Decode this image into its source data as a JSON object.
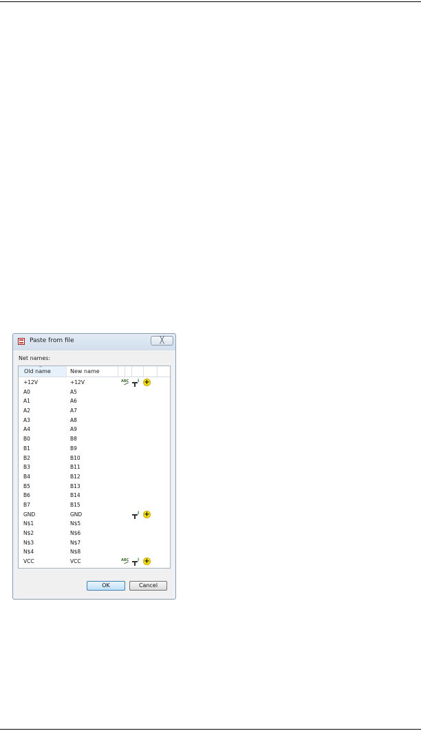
{
  "dialog": {
    "title": "Paste from file",
    "close_label": "╳",
    "net_names_label": "Net names:",
    "columns": {
      "old": "Old name",
      "new": "New name"
    },
    "rows": [
      {
        "old": "+12V",
        "new": "+12V",
        "icons": [
          "abc-rename-icon",
          "text-icon",
          "add-icon"
        ]
      },
      {
        "old": "A0",
        "new": "A5",
        "icons": []
      },
      {
        "old": "A1",
        "new": "A6",
        "icons": []
      },
      {
        "old": "A2",
        "new": "A7",
        "icons": []
      },
      {
        "old": "A3",
        "new": "A8",
        "icons": []
      },
      {
        "old": "A4",
        "new": "A9",
        "icons": []
      },
      {
        "old": "B0",
        "new": "B8",
        "icons": []
      },
      {
        "old": "B1",
        "new": "B9",
        "icons": []
      },
      {
        "old": "B2",
        "new": "B10",
        "icons": []
      },
      {
        "old": "B3",
        "new": "B11",
        "icons": []
      },
      {
        "old": "B4",
        "new": "B12",
        "icons": []
      },
      {
        "old": "B5",
        "new": "B13",
        "icons": []
      },
      {
        "old": "B6",
        "new": "B14",
        "icons": []
      },
      {
        "old": "B7",
        "new": "B15",
        "icons": []
      },
      {
        "old": "GND",
        "new": "GND",
        "icons": [
          "text-icon",
          "add-icon"
        ]
      },
      {
        "old": "N$1",
        "new": "N$5",
        "icons": []
      },
      {
        "old": "N$2",
        "new": "N$6",
        "icons": []
      },
      {
        "old": "N$3",
        "new": "N$7",
        "icons": []
      },
      {
        "old": "N$4",
        "new": "N$8",
        "icons": []
      },
      {
        "old": "VCC",
        "new": "VCC",
        "icons": [
          "abc-rename-icon",
          "text-icon",
          "add-icon"
        ]
      }
    ],
    "ok_label": "OK",
    "cancel_label": "Cancel"
  },
  "colors": {
    "accent": "#3c7fb1",
    "add_icon": "#f5e20f"
  }
}
